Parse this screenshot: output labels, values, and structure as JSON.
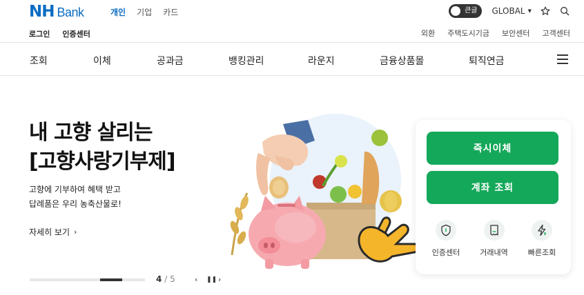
{
  "brand": {
    "logo_main": "NH",
    "logo_sub": "Bank"
  },
  "site_tabs": [
    {
      "label": "개인",
      "active": true
    },
    {
      "label": "기업",
      "active": false
    },
    {
      "label": "카드",
      "active": false
    }
  ],
  "top_right": {
    "toggle_label": "큰글",
    "global_label": "GLOBAL"
  },
  "util_left": [
    "로그인",
    "인증센터"
  ],
  "util_right": [
    "외환",
    "주택도시기금",
    "보안센터",
    "고객센터"
  ],
  "main_nav": [
    "조회",
    "이체",
    "공과금",
    "뱅킹관리",
    "라운지",
    "금융상품몰",
    "퇴직연금"
  ],
  "hero": {
    "title_line1": "내 고향 살리는",
    "title_line2": "[고향사랑기부제]",
    "desc_line1": "고향에 기부하여 혜택 받고",
    "desc_line2": "답례품은 우리 농축산물로!",
    "more_label": "자세히 보기",
    "page_current": "4",
    "page_sep": "/",
    "page_total": "5",
    "progress_fraction": 0.8
  },
  "quick_panel": {
    "buttons": [
      "즉시이체",
      "계좌 조회"
    ],
    "icons": [
      {
        "label": "인증센터",
        "icon": "shield-icon"
      },
      {
        "label": "거래내역",
        "icon": "receipt-icon"
      },
      {
        "label": "빠른조회",
        "icon": "lightning-icon"
      }
    ]
  },
  "colors": {
    "brand_blue": "#0a6cc2",
    "action_green": "#14a85a"
  }
}
